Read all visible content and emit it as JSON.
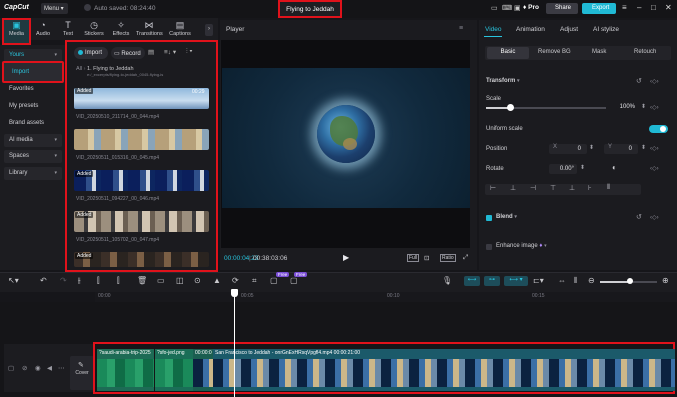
{
  "app": {
    "logo": "CapCut",
    "menu_label": "Menu",
    "autosave_text": "Auto saved: 08:24:40",
    "project_title": "Flying to Jeddah"
  },
  "titlebar": {
    "pro_label": "Pro",
    "share_label": "Share",
    "export_label": "Export"
  },
  "toolbar": {
    "items": [
      "Media",
      "Audio",
      "Text",
      "Stickers",
      "Effects",
      "Transitions",
      "Captions"
    ]
  },
  "sidebar": {
    "yours_label": "Yours",
    "items": [
      "Import",
      "Favorites",
      "My presets",
      "Brand assets"
    ],
    "ai_media_label": "AI media",
    "spaces_label": "Spaces",
    "library_label": "Library"
  },
  "media": {
    "import_label": "Import",
    "record_label": "Record",
    "breadcrumb_all": "All",
    "breadcrumb_folder": "1. Flying to Jeddah",
    "breadcrumb_sub": "e:/_excerpts/flying-to-jeddah_0045-flying-is",
    "added_label": "Added",
    "first_duration": "00:29",
    "clips": [
      "VID_20250510_211714_00_044.mp4",
      "VID_20250511_015316_00_045.mp4",
      "VID_20250511_094227_00_046.mp4",
      "VID_20250511_105702_00_047.mp4"
    ]
  },
  "player": {
    "title": "Player",
    "current_time": "00:00:04:23",
    "total_time": "00:38:03:06",
    "full_label": "Full",
    "ratio_label": "Ratio"
  },
  "properties": {
    "tabs": [
      "Video",
      "Animation",
      "Adjust",
      "AI stylize"
    ],
    "subtabs": [
      "Basic",
      "Remove BG",
      "Mask",
      "Retouch"
    ],
    "transform_label": "Transform",
    "scale_label": "Scale",
    "scale_value": "100%",
    "scale_fraction": 0.2,
    "uniform_scale_label": "Uniform scale",
    "position_label": "Position",
    "pos_x_label": "X",
    "pos_x": "0",
    "pos_y_label": "Y",
    "pos_y": "0",
    "rotate_label": "Rotate",
    "rotate_value": "0.00°",
    "blend_label": "Blend",
    "enhance_label": "Enhance image"
  },
  "timeline": {
    "free_label": "Free",
    "ruler": [
      "00:00",
      "00:05",
      "00:10",
      "00:15"
    ],
    "cover_label": "Cover",
    "clips": [
      {
        "label": "?saudi-arabia-trip-2025"
      },
      {
        "label": "?sfo-jed.png"
      },
      {
        "label": "00:00:0"
      },
      {
        "label": "San Francisco to Jeddah - onrGnExHRsqVpgfl4.mp4   00:00:21:00"
      }
    ]
  }
}
